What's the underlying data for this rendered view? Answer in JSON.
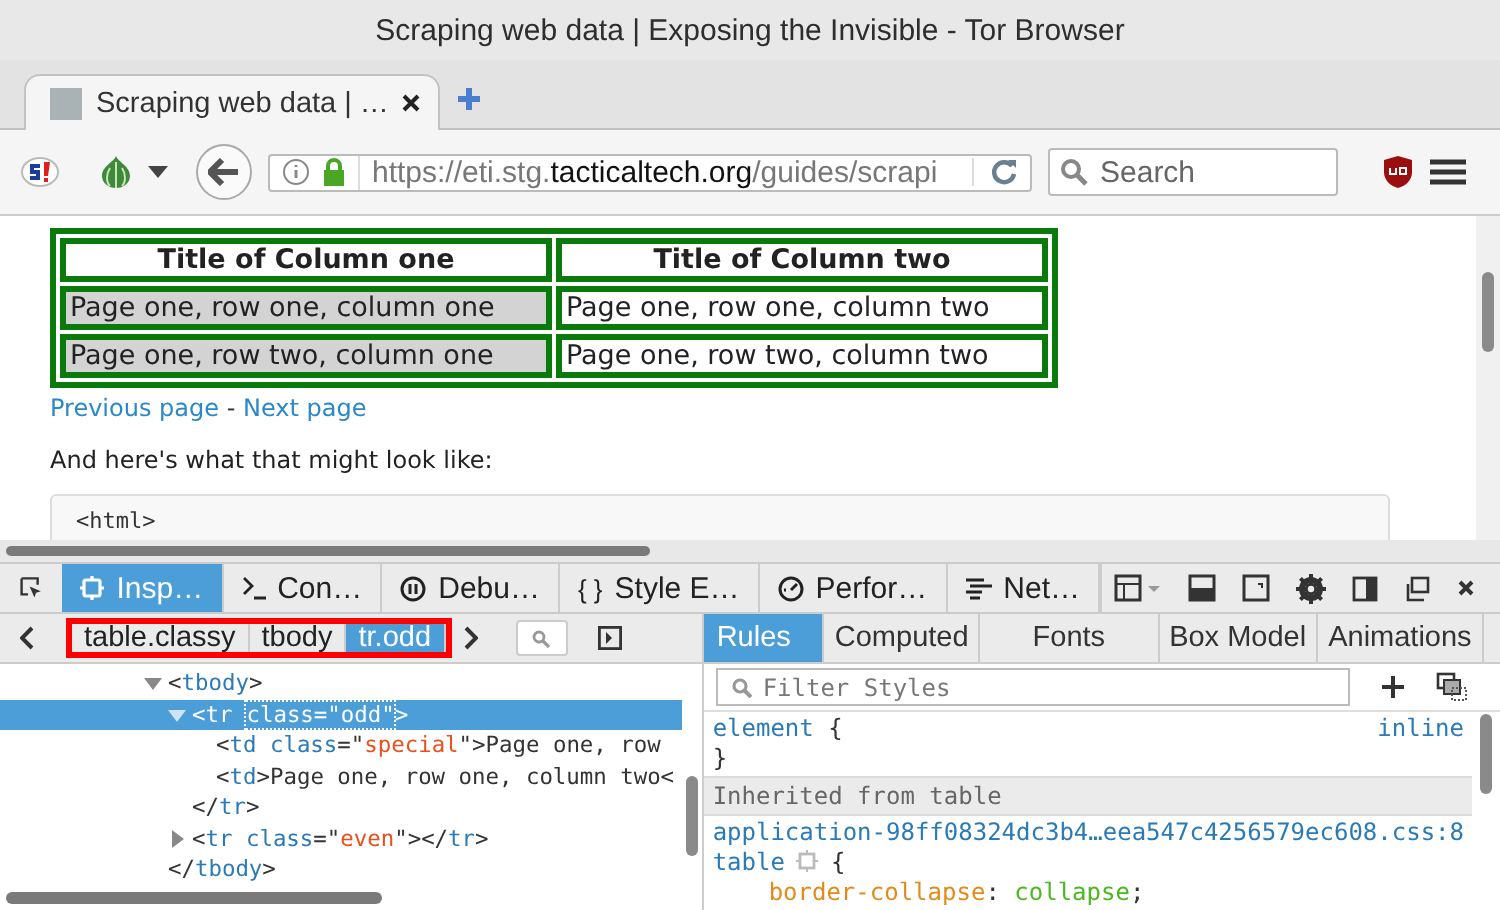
{
  "window": {
    "title": "Scraping web data | Exposing the Invisible - Tor Browser"
  },
  "browser_tabs": [
    {
      "title": "Scraping web data | …",
      "selected": true
    }
  ],
  "address_bar": {
    "url_parts": [
      {
        "text": "https://eti.stg.",
        "kind": "dim"
      },
      {
        "text": "tacticaltech.org",
        "kind": "domain"
      },
      {
        "text": "/guides/scrapi",
        "kind": "dim"
      }
    ]
  },
  "search": {
    "placeholder": "Search"
  },
  "page": {
    "table": {
      "columns": [
        "Title of Column one",
        "Title of Column two"
      ],
      "rows": [
        {
          "cells": [
            {
              "text": "Page one, row one, column one",
              "highlighted": true
            },
            {
              "text": "Page one, row one, column two",
              "highlighted": false
            }
          ]
        },
        {
          "cells": [
            {
              "text": "Page one, row two, column one",
              "highlighted": true
            },
            {
              "text": "Page one, row two, column two",
              "highlighted": false
            }
          ]
        }
      ]
    },
    "pager": [
      {
        "text": "Previous page",
        "kind": "link"
      },
      {
        "text": " - ",
        "kind": "separator"
      },
      {
        "text": "Next page",
        "kind": "link"
      }
    ],
    "paragraph": "And here's what that might look like:",
    "code": "<html>"
  },
  "devtools": {
    "tabs": [
      {
        "label": "Insp…",
        "kind": "inspector",
        "selected": true
      },
      {
        "label": "Con…",
        "kind": "console",
        "selected": false
      },
      {
        "label": "Debu…",
        "kind": "debugger",
        "selected": false
      },
      {
        "label": "Style E…",
        "kind": "style-editor",
        "glyph": "{ }",
        "selected": false
      },
      {
        "label": "Perfor…",
        "kind": "performance",
        "selected": false
      },
      {
        "label": "Net…",
        "kind": "network",
        "selected": false
      }
    ],
    "breadcrumbs": [
      {
        "label": "table.classy",
        "selected": false
      },
      {
        "label": "tbody",
        "selected": false
      },
      {
        "label": "tr.odd",
        "selected": true
      }
    ],
    "markup_tree": [
      {
        "expanded": true,
        "selected": false,
        "tokens": [
          {
            "text": "<",
            "kind": "punct"
          },
          {
            "text": "tbody",
            "kind": "tag"
          },
          {
            "text": ">",
            "kind": "punct"
          }
        ],
        "children": [
          {
            "expanded": true,
            "selected": true,
            "tokens": [
              {
                "text": "<",
                "kind": "punct"
              },
              {
                "text": "tr",
                "kind": "tag"
              },
              {
                "text": "class=\"odd\"",
                "kind": "focus"
              },
              {
                "text": ">",
                "kind": "punct"
              }
            ],
            "children": [
              {
                "tokens": [
                  {
                    "text": "<",
                    "kind": "punct"
                  },
                  {
                    "text": "td",
                    "kind": "tag"
                  },
                  {
                    "text": " class",
                    "kind": "attr"
                  },
                  {
                    "text": "=\"",
                    "kind": "punct"
                  },
                  {
                    "text": "special",
                    "kind": "value"
                  },
                  {
                    "text": "\">",
                    "kind": "punct"
                  },
                  {
                    "text": "Page one, row",
                    "kind": "text"
                  }
                ]
              },
              {
                "tokens": [
                  {
                    "text": "<",
                    "kind": "punct"
                  },
                  {
                    "text": "td",
                    "kind": "tag"
                  },
                  {
                    "text": ">",
                    "kind": "punct"
                  },
                  {
                    "text": "Page one, row one, column two<",
                    "kind": "text"
                  }
                ]
              }
            ]
          },
          {
            "tokens": [
              {
                "text": "</",
                "kind": "punct"
              },
              {
                "text": "tr",
                "kind": "tag"
              },
              {
                "text": ">",
                "kind": "punct"
              }
            ]
          },
          {
            "expanded": false,
            "selected": false,
            "tokens": [
              {
                "text": "<",
                "kind": "punct"
              },
              {
                "text": "tr",
                "kind": "tag"
              },
              {
                "text": " class",
                "kind": "attr"
              },
              {
                "text": "=\"",
                "kind": "punct"
              },
              {
                "text": "even",
                "kind": "value"
              },
              {
                "text": "\"></",
                "kind": "punct"
              },
              {
                "text": "tr",
                "kind": "tag"
              },
              {
                "text": ">",
                "kind": "punct"
              }
            ]
          }
        ]
      },
      {
        "tokens": [
          {
            "text": "</",
            "kind": "punct"
          },
          {
            "text": "tbody",
            "kind": "tag"
          },
          {
            "text": ">",
            "kind": "punct"
          }
        ]
      }
    ],
    "sidebar_tabs": [
      {
        "label": "Rules",
        "selected": true
      },
      {
        "label": "Computed",
        "selected": false
      },
      {
        "label": "Fonts",
        "selected": false
      },
      {
        "label": "Box Model",
        "selected": false
      },
      {
        "label": "Animations",
        "selected": false
      }
    ],
    "filter": {
      "placeholder": "Filter Styles"
    },
    "rules": {
      "element_selector": "element",
      "open_brace": "{",
      "close_brace": "}",
      "element_source": "inline",
      "inherited_header": "Inherited from table",
      "source": "application-98ff08324dc3b4…eea547c4256579ec608.css:8",
      "selector": "table",
      "property": "border-collapse",
      "colon": ":",
      "value": "collapse",
      "semicolon": ";"
    }
  }
}
